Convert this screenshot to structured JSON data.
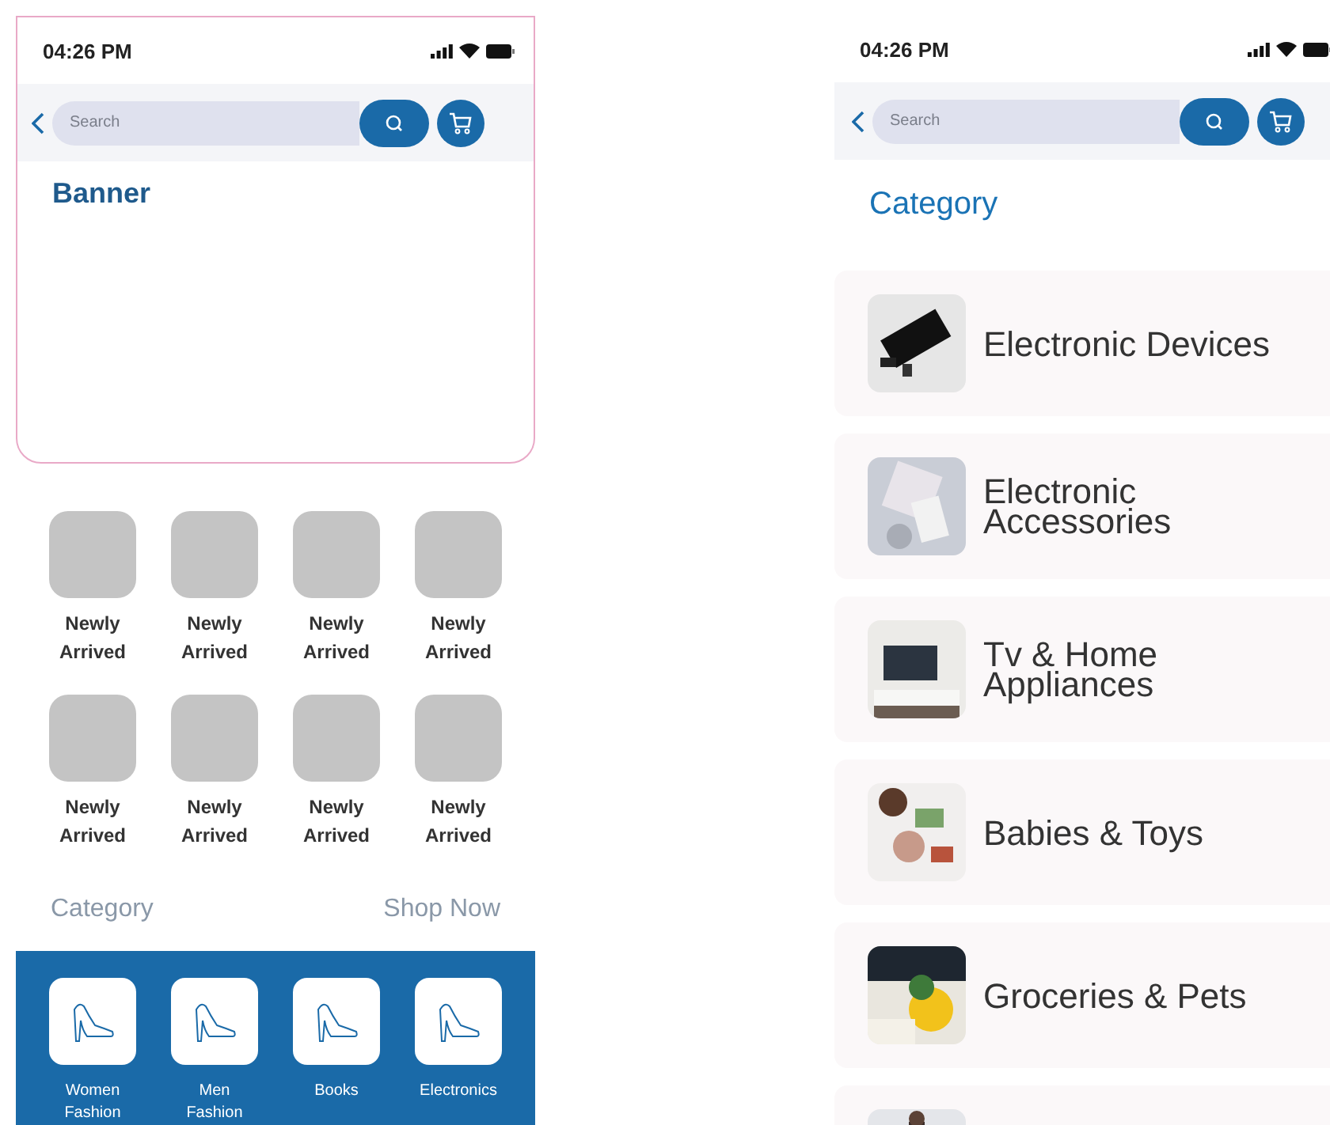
{
  "left_screen": {
    "status_bar": {
      "time": "04:26 PM"
    },
    "search": {
      "placeholder": "Search"
    },
    "banner": {
      "title": "Banner"
    },
    "tiles": [
      {
        "label": "Newly Arrived"
      },
      {
        "label": "Newly Arrived"
      },
      {
        "label": "Newly Arrived"
      },
      {
        "label": "Newly Arrived"
      },
      {
        "label": "Newly Arrived"
      },
      {
        "label": "Newly Arrived"
      },
      {
        "label": "Newly Arrived"
      },
      {
        "label": "Newly Arrived"
      }
    ],
    "section": {
      "title": "Category",
      "action": "Shop Now"
    },
    "categories": [
      {
        "label": "Women Fashion"
      },
      {
        "label": "Men Fashion"
      },
      {
        "label": "Books"
      },
      {
        "label": "Electronics"
      }
    ]
  },
  "right_screen": {
    "status_bar": {
      "time": "04:26 PM"
    },
    "search": {
      "placeholder": "Search"
    },
    "title": "Category",
    "categories": [
      {
        "label": "Electronic Devices",
        "kind": "picture"
      },
      {
        "label": "Electronic Accessories",
        "kind": "picture"
      },
      {
        "label": "Tv & Home Appliances",
        "kind": "picture"
      },
      {
        "label": "Babies & Toys",
        "kind": "picture"
      },
      {
        "label": "Groceries & Pets",
        "kind": "picture"
      },
      {
        "kind": "picture"
      }
    ]
  }
}
